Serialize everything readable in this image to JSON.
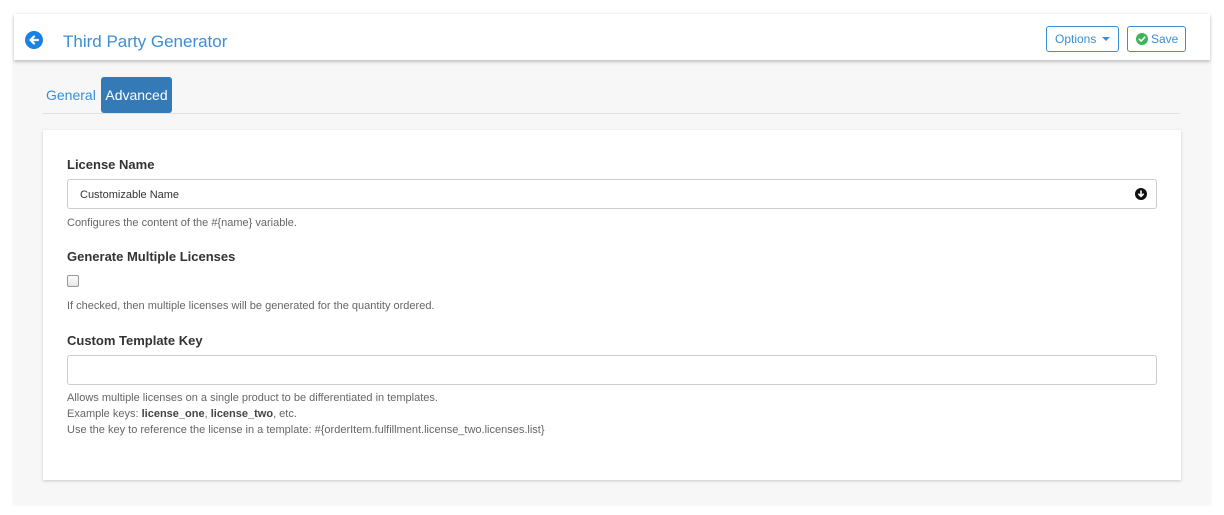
{
  "header": {
    "title": "Third Party Generator",
    "options_label": "Options",
    "save_label": "Save"
  },
  "tabs": [
    {
      "label": "General",
      "active": false
    },
    {
      "label": "Advanced",
      "active": true
    }
  ],
  "form": {
    "license_name": {
      "label": "License Name",
      "value": "Customizable Name",
      "help": "Configures the content of the #{name} variable."
    },
    "multiple_licenses": {
      "label": "Generate Multiple Licenses",
      "checked": false,
      "help": "If checked, then multiple licenses will be generated for the quantity ordered."
    },
    "template_key": {
      "label": "Custom Template Key",
      "value": "",
      "help_line1": "Allows multiple licenses on a single product to be differentiated in templates.",
      "help_line2_prefix": "Example keys: ",
      "help_key1": "license_one",
      "help_sep": ", ",
      "help_key2": "license_two",
      "help_line2_suffix": ", etc.",
      "help_line3": "Use the key to reference the license in a template: #{orderItem.fulfillment.license_two.licenses.list}"
    }
  },
  "icons": {
    "back": "arrow-left-circle-icon",
    "caret": "caret-down-icon",
    "save": "check-circle-icon",
    "download": "arrow-down-circle-icon"
  },
  "colors": {
    "accent": "#3a8fd6",
    "active_tab": "#337ab7",
    "back_icon": "#1a82e2",
    "success": "#3cb55a"
  }
}
